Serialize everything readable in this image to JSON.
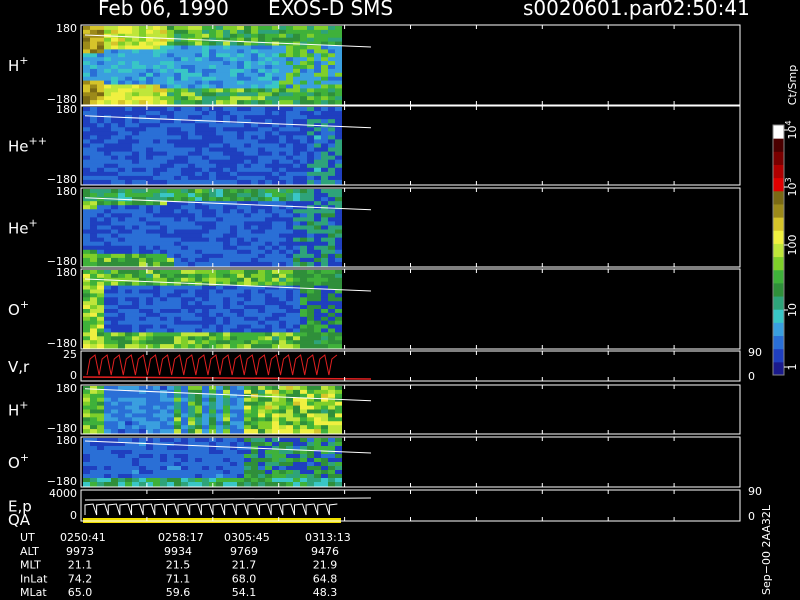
{
  "header": {
    "date": "Feb 06, 1990",
    "instrument": "EXOS-D SMS",
    "filename": "s0020601.par",
    "time": "02:50:41"
  },
  "chart_data": {
    "type": "heatmap",
    "panels": [
      {
        "label_base": "H",
        "label_sup": "+",
        "ymax": "180",
        "ymin": "−180"
      },
      {
        "label_base": "He",
        "label_sup": "++",
        "ymax": "180",
        "ymin": "−180"
      },
      {
        "label_base": "He",
        "label_sup": "+",
        "ymax": "180",
        "ymin": "−180"
      },
      {
        "label_base": "O",
        "label_sup": "+",
        "ymax": "180",
        "ymin": "−180"
      },
      {
        "label_base": "V,r",
        "label_sup": "",
        "ymax": "25",
        "ymin": "0",
        "right_max": "90",
        "right_min": "0",
        "line_plot": true
      },
      {
        "label_base": "H",
        "label_sup": "+",
        "ymax": "180",
        "ymin": "−180"
      },
      {
        "label_base": "O",
        "label_sup": "+",
        "ymax": "180",
        "ymin": "−180"
      },
      {
        "label_base": "E,p",
        "label_sup": "",
        "label2": "QA",
        "ymax": "4000",
        "ymin": "0",
        "right_max": "90",
        "right_min": "0",
        "line_plot": true
      }
    ],
    "colorbar": {
      "title": "Ct/Smp",
      "ticks": [
        "1",
        "10",
        "100",
        "10^3",
        "10^4"
      ],
      "colors": [
        "#1a1a8c",
        "#1f3fbf",
        "#2a6fd6",
        "#3a9fdf",
        "#39c6c6",
        "#2ea37a",
        "#2f8f3a",
        "#3fb13a",
        "#7fcf2a",
        "#bfe63a",
        "#f0f040",
        "#d6c42a",
        "#9c8a1a",
        "#7a6a14",
        "#e00000",
        "#b00000",
        "#7a0000",
        "#4a0000",
        "#ffffff"
      ]
    },
    "time_axis": {
      "rows": [
        {
          "label": "UT",
          "values": [
            "0250:41",
            "0258:17",
            "0305:45",
            "0313:13"
          ]
        },
        {
          "label": "ALT",
          "values": [
            "9973",
            "9934",
            "9769",
            "9476"
          ]
        },
        {
          "label": "MLT",
          "values": [
            "21.1",
            "21.5",
            "21.7",
            "21.9"
          ]
        },
        {
          "label": "InLat",
          "values": [
            "74.2",
            "71.1",
            "68.0",
            "64.8"
          ]
        },
        {
          "label": "MLat",
          "values": [
            "65.0",
            "59.6",
            "54.1",
            "48.3"
          ]
        }
      ]
    },
    "footer": "Sep−00  2AA32L"
  }
}
